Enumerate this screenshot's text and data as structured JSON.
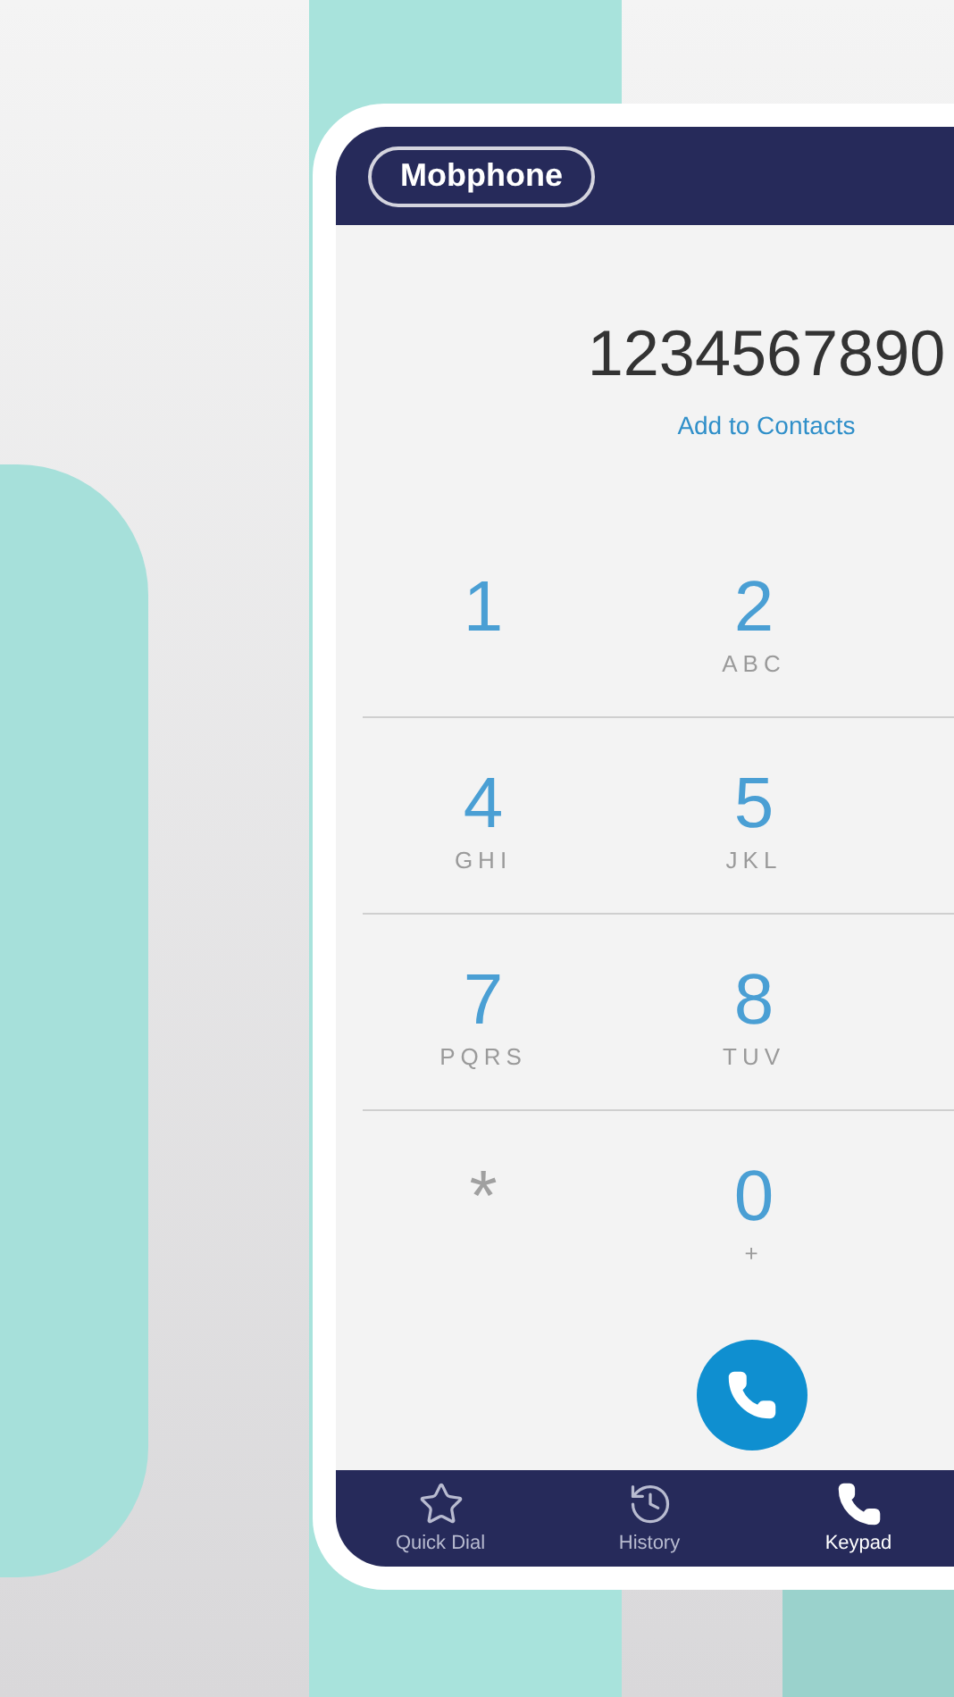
{
  "app": {
    "title": "Mobphone"
  },
  "dialer": {
    "number": "1234567890",
    "action": "Add to Contacts"
  },
  "keys": [
    {
      "kind": "digit",
      "label": "1"
    },
    {
      "kind": "digit",
      "label": "2",
      "letters": "ABC"
    },
    {
      "kind": "digit",
      "label": "4",
      "letters": "GHI"
    },
    {
      "kind": "digit",
      "label": "5",
      "letters": "JKL"
    },
    {
      "kind": "digit",
      "label": "7",
      "letters": "PQRS"
    },
    {
      "kind": "digit",
      "label": "8",
      "letters": "TUV"
    },
    {
      "kind": "symbol",
      "label": "*"
    },
    {
      "kind": "digit",
      "label": "0",
      "letters": "+"
    }
  ],
  "nav": [
    {
      "kind": "favorites",
      "label": "Quick Dial",
      "selected": false
    },
    {
      "kind": "history",
      "label": "History",
      "selected": false
    },
    {
      "kind": "keypad",
      "label": "Keypad",
      "selected": true
    }
  ]
}
